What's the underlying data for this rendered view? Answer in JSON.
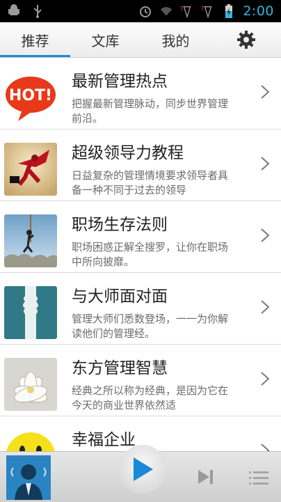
{
  "status_bar": {
    "time": "2:00",
    "icons": [
      "android-debug-icon",
      "usb-icon",
      "alarm-icon",
      "wifi-icon",
      "signal-1-icon",
      "signal-2-icon",
      "battery-charging-icon"
    ]
  },
  "tabs": [
    {
      "label": "推荐",
      "active": true
    },
    {
      "label": "文库",
      "active": false
    },
    {
      "label": "我的",
      "active": false
    }
  ],
  "settings_icon": "gear-icon",
  "colors": {
    "accent": "#1a8ad8",
    "statusbar_accent": "#33b5e5",
    "play_blue": "#1a8ad8"
  },
  "list": [
    {
      "title": "最新管理热点",
      "desc": "把握最新管理脉动，同步世界管理前沿。",
      "thumb": "hot-badge"
    },
    {
      "title": "超级领导力教程",
      "desc": "日益复杂的管理情境要求领导者具备一种不同于过去的领导",
      "thumb": "superhero-businessman"
    },
    {
      "title": "职场生存法则",
      "desc": "职场困惑正解全搜罗，让你在职场中所向披靡。",
      "thumb": "climbing-rope-man"
    },
    {
      "title": "与大师面对面",
      "desc": "管理大师们悉数登场，一一为你解读他们的管理经。",
      "thumb": "two-faces-silhouette"
    },
    {
      "title": "东方管理智慧",
      "desc": "经典之所以称为经典，是因为它在今天的商业世界依然适",
      "thumb": "white-lotus"
    },
    {
      "title": "幸福企业",
      "desc": "",
      "thumb": "smiley-face"
    }
  ],
  "player": {
    "avatar": "speaker-avatar",
    "play_icon": "play-icon",
    "next_icon": "skip-next-icon",
    "playlist_icon": "playlist-icon"
  }
}
